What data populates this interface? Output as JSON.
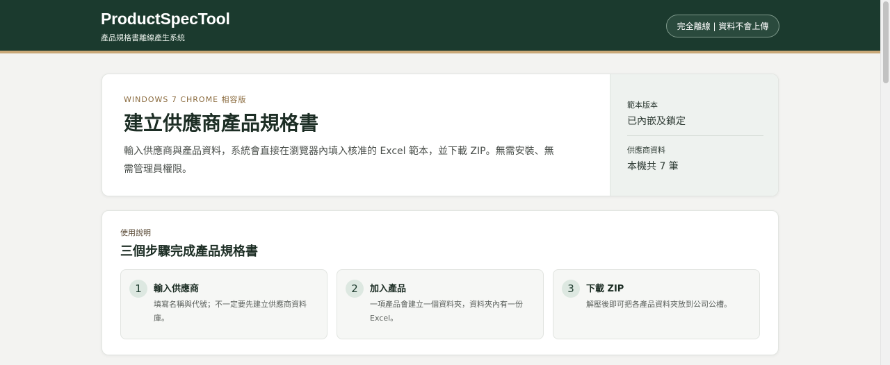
{
  "header": {
    "title": "ProductSpecTool",
    "subtitle": "產品規格書離線產生系統",
    "badge": "完全離線 | 資料不會上傳"
  },
  "hero": {
    "eyebrow": "WINDOWS 7 CHROME 相容版",
    "title": "建立供應商產品規格書",
    "description": "輸入供應商與產品資料，系統會直接在瀏覽器內填入核准的 Excel 範本，並下載 ZIP。無需安裝、無需管理員權限。",
    "template_label": "範本版本",
    "template_value": "已內嵌及鎖定",
    "supplier_label": "供應商資料",
    "supplier_value": "本機共 7 筆"
  },
  "guide": {
    "eyebrow": "使用說明",
    "title": "三個步驟完成產品規格書",
    "steps": [
      {
        "num": "1",
        "title": "輸入供應商",
        "desc": "填寫名稱與代號；不一定要先建立供應商資料庫。"
      },
      {
        "num": "2",
        "title": "加入產品",
        "desc": "一項產品會建立一個資料夾，資料夾內有一份 Excel。"
      },
      {
        "num": "3",
        "title": "下載 ZIP",
        "desc": "解壓後即可把各產品資料夾放到公司公槽。"
      }
    ]
  },
  "colors": {
    "header_bg": "#1b3a2e",
    "accent_line": "#c9a878",
    "eyebrow": "#8a6a3d"
  }
}
